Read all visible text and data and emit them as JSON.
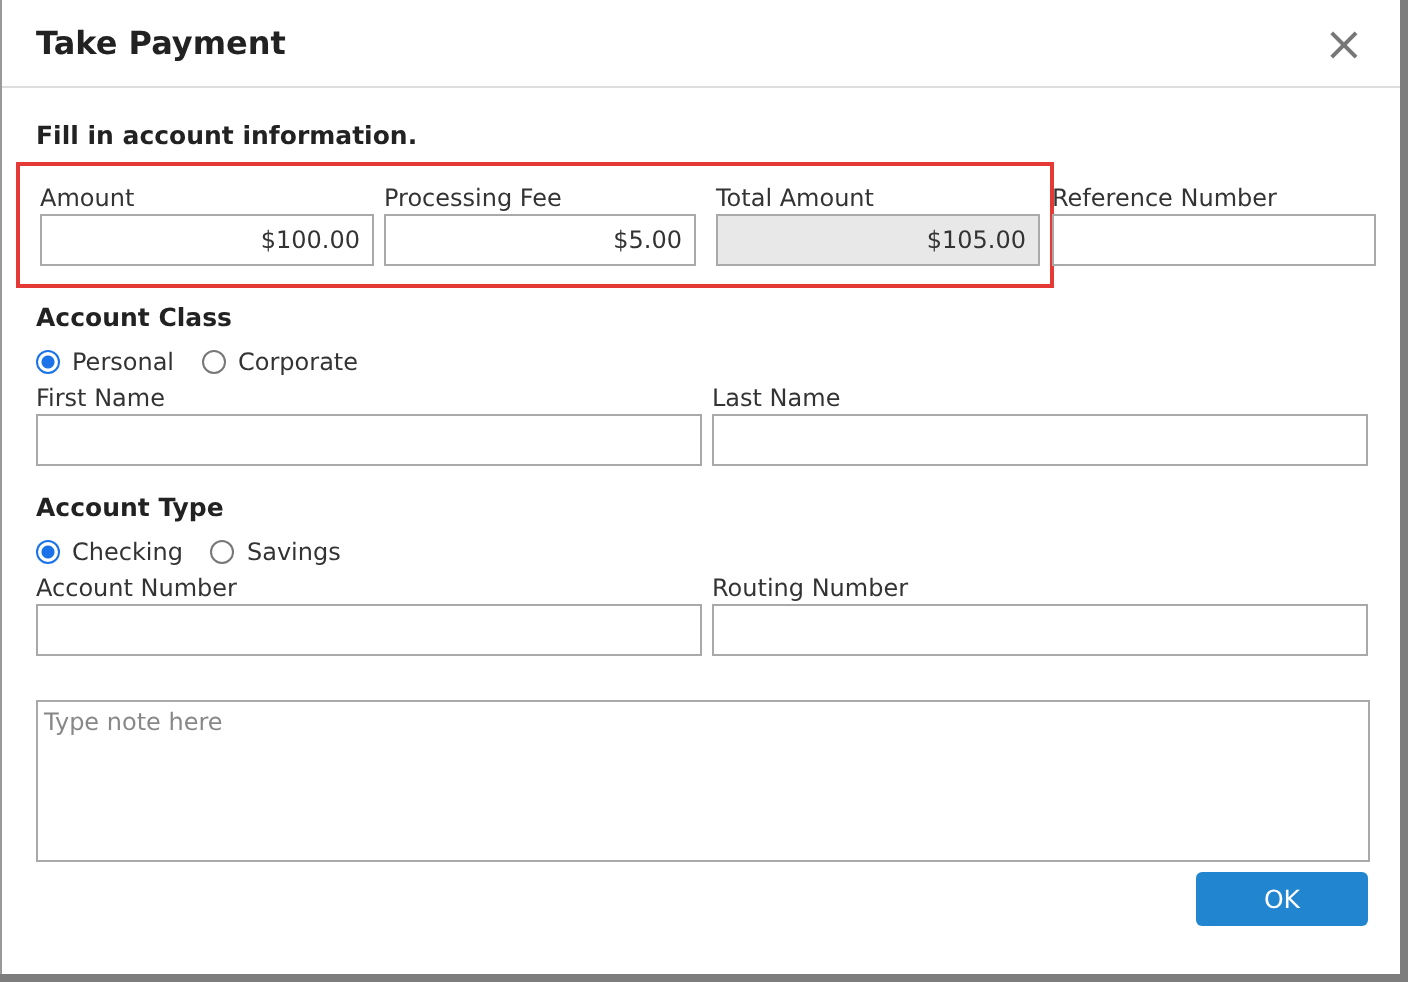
{
  "dialog": {
    "title": "Take Payment",
    "close": "×"
  },
  "intro": "Fill in account information.",
  "summary": {
    "highlighted": true,
    "fields": [
      {
        "label": "Amount",
        "value": "$100.00",
        "disabled": false
      },
      {
        "label": "Processing Fee",
        "value": "$5.00",
        "disabled": false
      },
      {
        "label": "Total Amount",
        "value": "$105.00",
        "disabled": true
      }
    ]
  },
  "reference_field": {
    "label": "Reference Number",
    "disabled": false
  },
  "sections": [
    {
      "heading": "Account Class",
      "options": [
        {
          "label": "Personal",
          "selected": true
        },
        {
          "label": "Corporate",
          "selected": false
        }
      ],
      "fields": [
        {
          "label": "First Name"
        },
        {
          "label": "Last Name"
        }
      ]
    },
    {
      "heading": "Account Type",
      "options": [
        {
          "label": "Checking",
          "selected": true
        },
        {
          "label": "Savings",
          "selected": false
        }
      ],
      "fields": [
        {
          "label": "Account Number"
        },
        {
          "label": "Routing Number"
        }
      ]
    }
  ],
  "note": {
    "placeholder": "Type note here"
  },
  "ok_button": "OK"
}
